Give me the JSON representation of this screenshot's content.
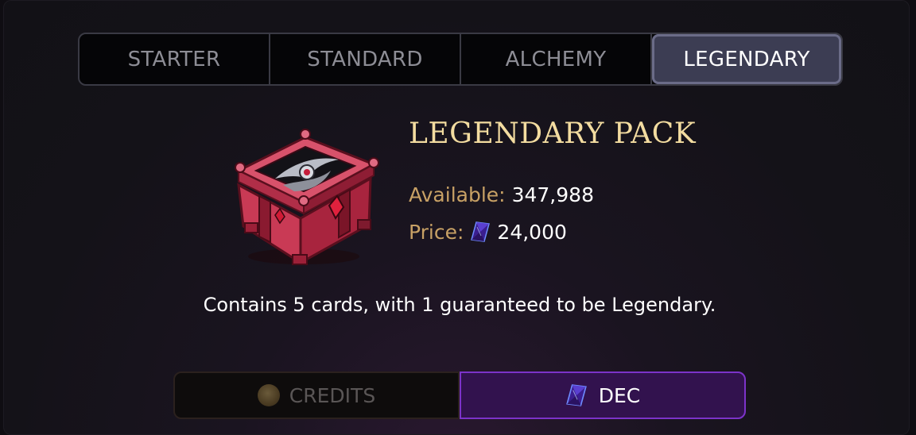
{
  "tabs": [
    {
      "label": "STARTER",
      "active": false
    },
    {
      "label": "STANDARD",
      "active": false
    },
    {
      "label": "ALCHEMY",
      "active": false
    },
    {
      "label": "LEGENDARY",
      "active": true
    }
  ],
  "pack": {
    "title": "LEGENDARY PACK",
    "available_label": "Available:",
    "available_value": "347,988",
    "price_label": "Price:",
    "price_value": "24,000",
    "price_icon": "dec-gem-icon",
    "image_icon": "legendary-chest-icon",
    "description": "Contains 5 cards, with 1 guaranteed to be Legendary."
  },
  "currency": {
    "credits_label": "CREDITS",
    "credits_icon": "credits-coin-icon",
    "dec_label": "DEC",
    "dec_icon": "dec-gem-icon",
    "selected": "DEC"
  },
  "colors": {
    "title": "#f3dca0",
    "label": "#c8a165",
    "active_tab": "#3c3d53",
    "dec_accent": "#7c33c9"
  }
}
